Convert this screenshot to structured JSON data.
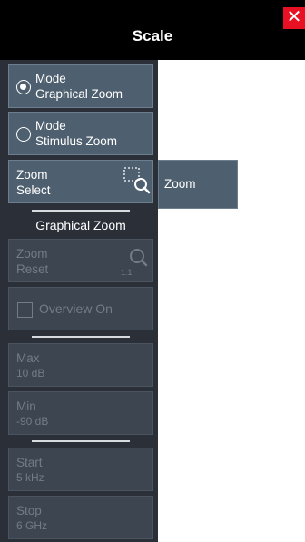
{
  "dialog": {
    "title": "Scale",
    "close_label": "✕"
  },
  "panel": {
    "mode_graphical": {
      "line1": "Mode",
      "line2": "Graphical Zoom",
      "selected": true
    },
    "mode_stimulus": {
      "line1": "Mode",
      "line2": "Stimulus Zoom",
      "selected": false
    },
    "zoom_select": {
      "line1": "Zoom",
      "line2": "Select"
    },
    "section_label": "Graphical Zoom",
    "zoom_reset": {
      "line1": "Zoom",
      "line2": "Reset",
      "badge": "1:1"
    },
    "overview": {
      "label": "Overview On",
      "checked": false
    },
    "max": {
      "label": "Max",
      "value": "10 dB"
    },
    "min": {
      "label": "Min",
      "value": "-90 dB"
    },
    "start": {
      "label": "Start",
      "value": "5 kHz"
    },
    "stop": {
      "label": "Stop",
      "value": "6 GHz"
    }
  },
  "softkey": {
    "label": "Zoom"
  },
  "colors": {
    "header": "#000000",
    "panel": "#2a2f38",
    "button": "#4e5f6f",
    "button_disabled": "#3d4550",
    "close": "#e81123"
  }
}
